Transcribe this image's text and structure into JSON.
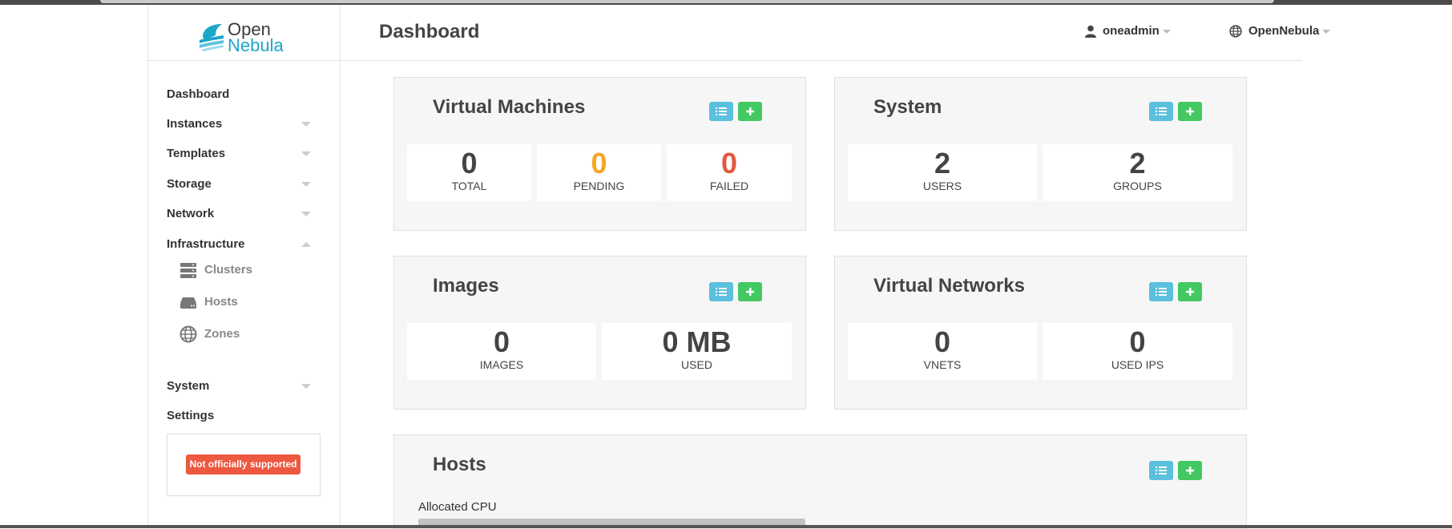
{
  "app": {
    "title": "Dashboard"
  },
  "brand": {
    "line1": "Open",
    "line2": "Nebula",
    "accent": "#1ca6c9"
  },
  "header": {
    "user": "oneadmin",
    "zone": "OpenNebula"
  },
  "sidebar": {
    "items": [
      {
        "label": "Dashboard"
      },
      {
        "label": "Instances"
      },
      {
        "label": "Templates"
      },
      {
        "label": "Storage"
      },
      {
        "label": "Network"
      },
      {
        "label": "Infrastructure"
      },
      {
        "label": "System"
      },
      {
        "label": "Settings"
      }
    ],
    "infrastructure_sub": [
      {
        "label": "Clusters",
        "icon": "server-icon"
      },
      {
        "label": "Hosts",
        "icon": "hdd-icon"
      },
      {
        "label": "Zones",
        "icon": "globe-icon"
      }
    ],
    "notice": "Not officially supported"
  },
  "panels": {
    "vms": {
      "title": "Virtual Machines",
      "stats": [
        {
          "value": "0",
          "label": "TOTAL",
          "color": "#444444"
        },
        {
          "value": "0",
          "label": "PENDING",
          "color": "#f5a623"
        },
        {
          "value": "0",
          "label": "FAILED",
          "color": "#e4573f"
        }
      ]
    },
    "system": {
      "title": "System",
      "stats": [
        {
          "value": "2",
          "label": "USERS"
        },
        {
          "value": "2",
          "label": "GROUPS"
        }
      ]
    },
    "images": {
      "title": "Images",
      "stats": [
        {
          "value": "0",
          "label": "IMAGES"
        },
        {
          "value": "0 MB",
          "label": "USED"
        }
      ]
    },
    "vnets": {
      "title": "Virtual Networks",
      "stats": [
        {
          "value": "0",
          "label": "VNETS"
        },
        {
          "value": "0",
          "label": "USED IPS"
        }
      ]
    },
    "hosts": {
      "title": "Hosts",
      "allocated_cpu_label": "Allocated CPU"
    }
  },
  "colors": {
    "list_button": "#5bc0de",
    "add_button": "#43c862",
    "notice": "#ec5840"
  }
}
